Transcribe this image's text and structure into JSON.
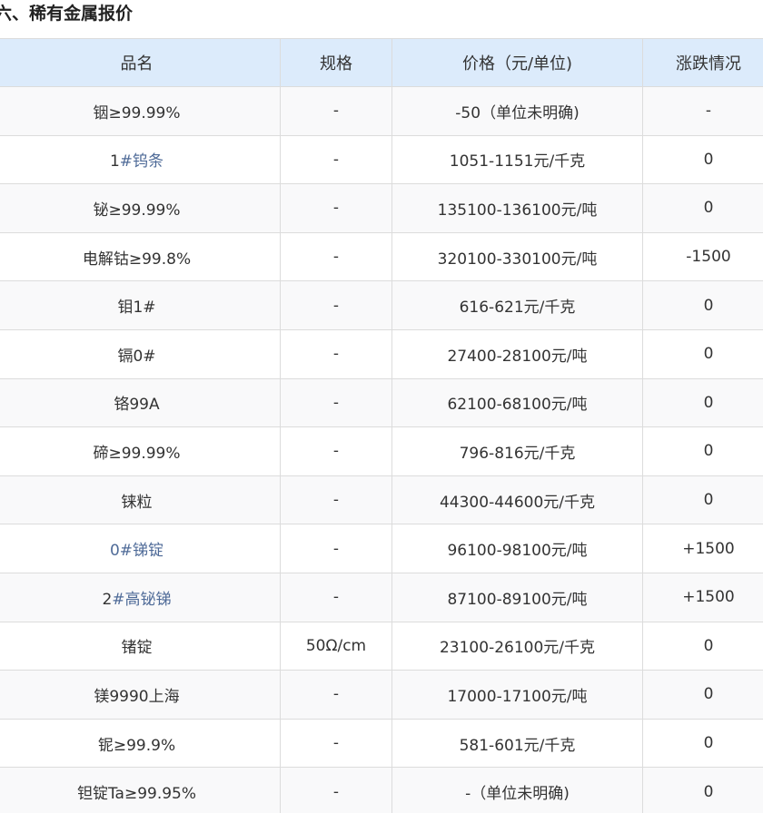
{
  "section": {
    "title": "六、稀有金属报价"
  },
  "table": {
    "headers": [
      "品名",
      "规格",
      "价格（元/单位)",
      "涨跌情况"
    ],
    "rows": [
      {
        "name_prefix": "",
        "name": "铟≥99.99%",
        "spec": "-",
        "price": "-50（单位未明确)",
        "change": "-"
      },
      {
        "name_prefix": "1",
        "name": "#钨条",
        "spec": "-",
        "price": "1051-1151元/千克",
        "change": "0"
      },
      {
        "name_prefix": "",
        "name": "铋≥99.99%",
        "spec": "-",
        "price": "135100-136100元/吨",
        "change": "0"
      },
      {
        "name_prefix": "",
        "name": "电解钴≥99.8%",
        "spec": "-",
        "price": "320100-330100元/吨",
        "change": "-1500"
      },
      {
        "name_prefix": "",
        "name": "钼1#",
        "spec": "-",
        "price": "616-621元/千克",
        "change": "0"
      },
      {
        "name_prefix": "",
        "name": "镉0#",
        "spec": "-",
        "price": "27400-28100元/吨",
        "change": "0"
      },
      {
        "name_prefix": "",
        "name": "铬99A",
        "spec": "-",
        "price": "62100-68100元/吨",
        "change": "0"
      },
      {
        "name_prefix": "",
        "name": "碲≥99.99%",
        "spec": "-",
        "price": "796-816元/千克",
        "change": "0"
      },
      {
        "name_prefix": "",
        "name": "铼粒",
        "spec": "-",
        "price": "44300-44600元/千克",
        "change": "0"
      },
      {
        "name_prefix": "0",
        "name": "#锑锭",
        "spec": "-",
        "price": "96100-98100元/吨",
        "change": "+1500"
      },
      {
        "name_prefix": "2",
        "name": "#高铋锑",
        "spec": "-",
        "price": "87100-89100元/吨",
        "change": "+1500"
      },
      {
        "name_prefix": "",
        "name": "锗锭",
        "spec": "50Ω/cm",
        "price": "23100-26100元/千克",
        "change": "0"
      },
      {
        "name_prefix": "",
        "name": "镁9990上海",
        "spec": "-",
        "price": "17000-17100元/吨",
        "change": "0"
      },
      {
        "name_prefix": "",
        "name": "铌≥99.9%",
        "spec": "-",
        "price": "581-601元/千克",
        "change": "0"
      },
      {
        "name_prefix": "",
        "name": "钽锭Ta≥99.95%",
        "spec": "-",
        "price": "-（单位未明确)",
        "change": "0"
      }
    ]
  },
  "colors": {
    "header_bg": "#dcebfb",
    "link": "#4f6b98",
    "border": "#dcdcdc"
  }
}
